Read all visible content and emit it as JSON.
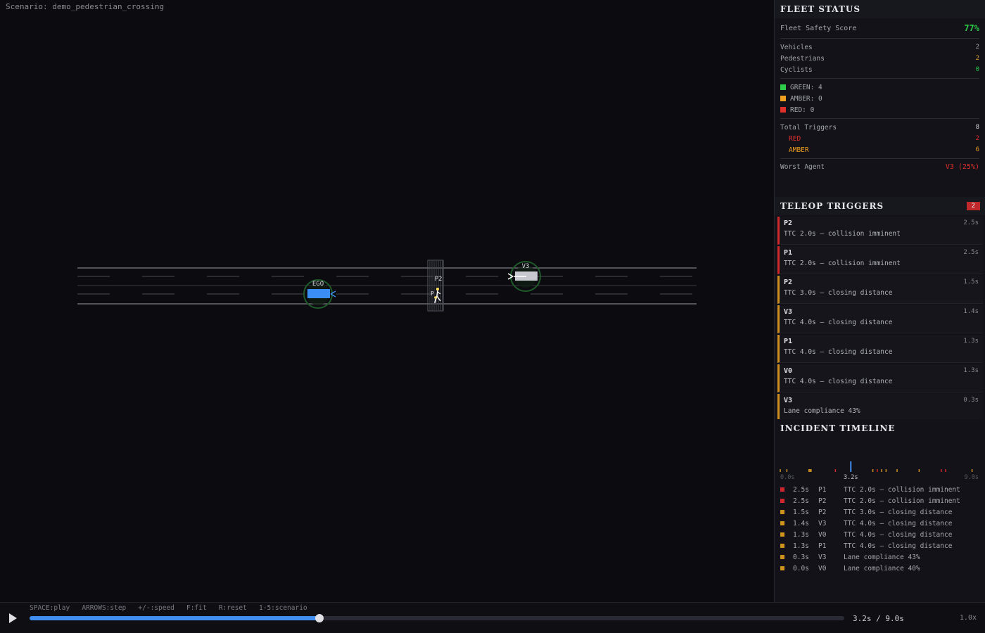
{
  "scenario": {
    "label": "Scenario: demo_pedestrian_crossing"
  },
  "scene": {
    "agents": [
      {
        "id": "EGO",
        "kind": "vehicle",
        "color": "#3a8ef5",
        "status": "GREEN"
      },
      {
        "id": "V3",
        "kind": "vehicle",
        "color": "#c8c8d0",
        "status": "GREEN"
      },
      {
        "id": "P2",
        "kind": "pedestrian",
        "color": "#ffffff",
        "status": "GREEN"
      },
      {
        "id": "P1",
        "kind": "pedestrian",
        "color": "#ffffff",
        "status": "GREEN"
      }
    ],
    "road_color": "#6a6a74",
    "crosswalk_color": "#5a5a66"
  },
  "fleet": {
    "title": "FLEET STATUS",
    "score_label": "Fleet Safety Score",
    "score_value": "77%",
    "counts": [
      {
        "label": "Vehicles",
        "value": "2",
        "color": "#a4a4ac"
      },
      {
        "label": "Pedestrians",
        "value": "2",
        "color": "#e0a030"
      },
      {
        "label": "Cyclists",
        "value": "0",
        "color": "#2ecc4a"
      }
    ],
    "legend": [
      {
        "label": "GREEN: 4",
        "color": "#2ecc4a"
      },
      {
        "label": "AMBER: 0",
        "color": "#f0a020"
      },
      {
        "label": "RED: 0",
        "color": "#e0302c"
      }
    ],
    "total_triggers_label": "Total Triggers",
    "total_triggers_value": "8",
    "red_label": "RED",
    "red_value": "2",
    "amber_label": "AMBER",
    "amber_value": "6",
    "worst_label": "Worst Agent",
    "worst_value": "V3 (25%)"
  },
  "teleop": {
    "title": "TELEOP TRIGGERS",
    "badge": "2",
    "items": [
      {
        "agent": "P2",
        "time": "2.5s",
        "desc": "TTC 2.0s — collision imminent",
        "level": "red"
      },
      {
        "agent": "P1",
        "time": "2.5s",
        "desc": "TTC 2.0s — collision imminent",
        "level": "red"
      },
      {
        "agent": "P2",
        "time": "1.5s",
        "desc": "TTC 3.0s — closing distance",
        "level": "amber"
      },
      {
        "agent": "V3",
        "time": "1.4s",
        "desc": "TTC 4.0s — closing distance",
        "level": "amber"
      },
      {
        "agent": "P1",
        "time": "1.3s",
        "desc": "TTC 4.0s — closing distance",
        "level": "amber"
      },
      {
        "agent": "V0",
        "time": "1.3s",
        "desc": "TTC 4.0s — closing distance",
        "level": "amber"
      },
      {
        "agent": "V3",
        "time": "0.3s",
        "desc": "Lane compliance 43%",
        "level": "amber"
      }
    ]
  },
  "timeline": {
    "title": "INCIDENT TIMELINE",
    "start_label": "0.0s",
    "current_label": "3.2s",
    "end_label": "9.0s",
    "current": 3.2,
    "duration": 9.0,
    "ticks": [
      {
        "t": 0.0,
        "level": "amber"
      },
      {
        "t": 0.3,
        "level": "amber"
      },
      {
        "t": 1.3,
        "level": "amber"
      },
      {
        "t": 1.35,
        "level": "amber"
      },
      {
        "t": 1.4,
        "level": "amber"
      },
      {
        "t": 2.5,
        "level": "red"
      },
      {
        "t": 4.2,
        "level": "amber"
      },
      {
        "t": 4.4,
        "level": "red"
      },
      {
        "t": 4.6,
        "level": "amber"
      },
      {
        "t": 4.8,
        "level": "amber"
      },
      {
        "t": 5.3,
        "level": "amber"
      },
      {
        "t": 6.3,
        "level": "amber"
      },
      {
        "t": 7.3,
        "level": "red"
      },
      {
        "t": 7.5,
        "level": "red"
      },
      {
        "t": 8.7,
        "level": "amber"
      }
    ],
    "incidents": [
      {
        "time": "2.5s",
        "agent": "P1",
        "desc": "TTC 2.0s — collision imminent",
        "level": "red"
      },
      {
        "time": "2.5s",
        "agent": "P2",
        "desc": "TTC 2.0s — collision imminent",
        "level": "red"
      },
      {
        "time": "1.5s",
        "agent": "P2",
        "desc": "TTC 3.0s — closing distance",
        "level": "amber"
      },
      {
        "time": "1.4s",
        "agent": "V3",
        "desc": "TTC 4.0s — closing distance",
        "level": "amber"
      },
      {
        "time": "1.3s",
        "agent": "V0",
        "desc": "TTC 4.0s — closing distance",
        "level": "amber"
      },
      {
        "time": "1.3s",
        "agent": "P1",
        "desc": "TTC 4.0s — closing distance",
        "level": "amber"
      },
      {
        "time": "0.3s",
        "agent": "V3",
        "desc": "Lane compliance 43%",
        "level": "amber"
      },
      {
        "time": "0.0s",
        "agent": "V0",
        "desc": "Lane compliance 40%",
        "level": "amber"
      }
    ]
  },
  "controls": {
    "shortcuts": "SPACE:play   ARROWS:step   +/-:speed   F:fit   R:reset   1-5:scenario",
    "time_readout": "3.2s / 9.0s",
    "speed": "1.0x",
    "progress": 0.356,
    "play_icon": "play-icon"
  },
  "colors": {
    "red": "#d0282c",
    "amber": "#d09020",
    "green": "#2ecc4a",
    "accent": "#3f8ef0"
  }
}
